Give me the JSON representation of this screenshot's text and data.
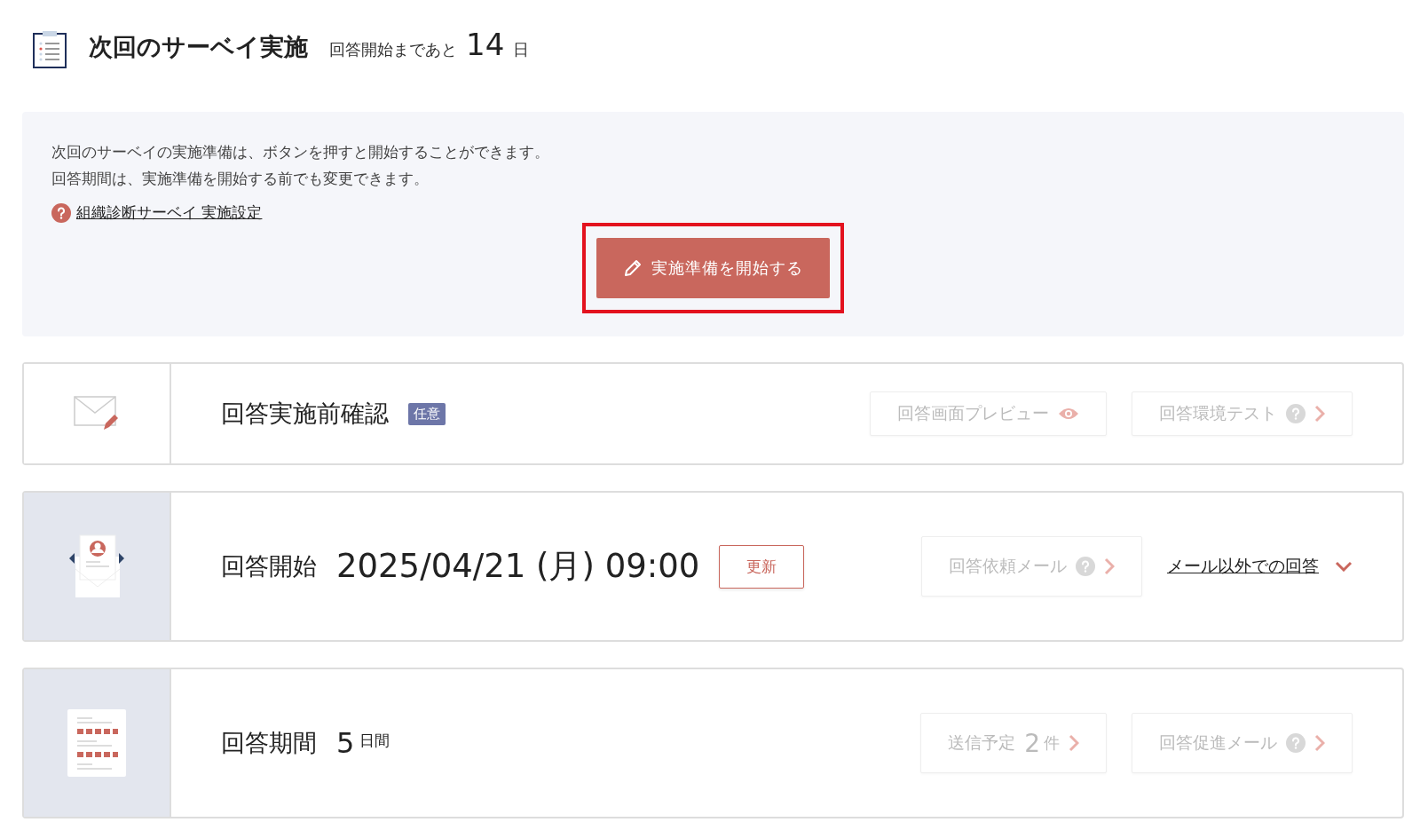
{
  "header": {
    "title": "次回のサーベイ実施",
    "countdown_label": "回答開始まであと",
    "countdown_value": "14",
    "countdown_unit": "日"
  },
  "notice": {
    "lines": [
      "次回のサーベイの実施準備は、ボタンを押すと開始することができます。",
      "回答期間は、実施準備を開始する前でも変更できます。"
    ],
    "help_link": "組織診断サーベイ 実施設定",
    "button": {
      "label": "実施準備を開始する",
      "highlighted": true
    }
  },
  "cards": [
    {
      "shaded": false,
      "title": "回答実施前確認",
      "tag": "任意",
      "actions": [
        {
          "kind": "preview",
          "label": "回答画面プレビュー",
          "disabled": true
        },
        {
          "kind": "nav",
          "label": "回答環境テスト",
          "help": true,
          "disabled": true
        }
      ]
    },
    {
      "shaded": true,
      "title": "回答開始",
      "value": "2025/04/21 (月) 09:00",
      "edit_button": "更新",
      "actions": [
        {
          "kind": "nav",
          "label": "回答依頼メール",
          "help": true,
          "disabled": true
        },
        {
          "kind": "link",
          "label": "メール以外での回答",
          "expanded": false
        }
      ]
    },
    {
      "shaded": true,
      "title": "回答期間",
      "value": "5",
      "unit": "日間",
      "actions": [
        {
          "kind": "count",
          "label": "送信予定",
          "count": "2",
          "unit": "件",
          "disabled": true
        },
        {
          "kind": "nav",
          "label": "回答促進メール",
          "help": true,
          "disabled": true
        }
      ]
    }
  ]
}
